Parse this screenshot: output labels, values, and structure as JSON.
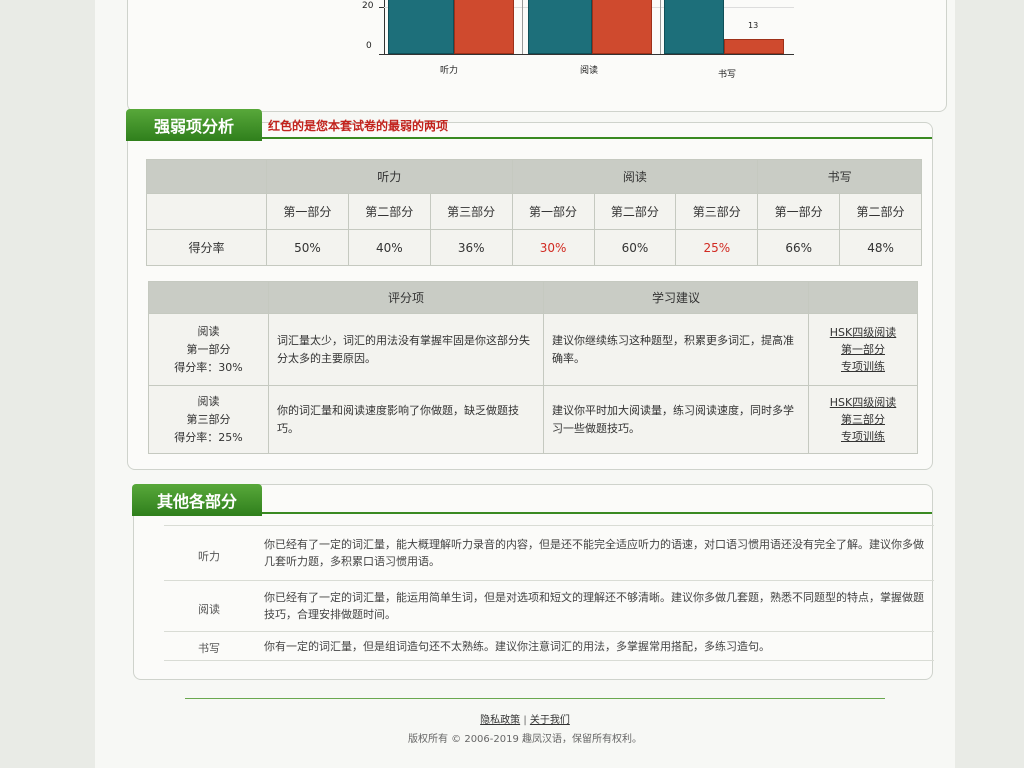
{
  "chart_data": {
    "type": "bar",
    "categories": [
      "听力",
      "阅读",
      "书写"
    ],
    "y_ticks_visible": [
      "20",
      "0"
    ],
    "series": [
      {
        "color": "#1d6f7a",
        "values": [
          null,
          null,
          null
        ]
      },
      {
        "color": "#cf4a2e",
        "values": [
          null,
          null,
          13
        ]
      }
    ],
    "data_labels": [
      "13"
    ]
  },
  "weak": {
    "title": "强弱项分析",
    "note": "红色的是您本套试卷的最弱的两项",
    "groups": [
      "听力",
      "阅读",
      "书写"
    ],
    "parts": [
      "第一部分",
      "第二部分",
      "第三部分",
      "第一部分",
      "第二部分",
      "第三部分",
      "第一部分",
      "第二部分"
    ],
    "row_label": "得分率",
    "rates": [
      "50%",
      "40%",
      "36%",
      "30%",
      "60%",
      "25%",
      "66%",
      "48%"
    ],
    "highlight_color": "#d12a22"
  },
  "advice": {
    "headers": [
      "评分项",
      "学习建议"
    ],
    "rows": [
      {
        "section": "阅读",
        "part": "第一部分",
        "rate": "得分率：30%",
        "eval": "词汇量太少，词汇的用法没有掌握牢固是你这部分失分太多的主要原因。",
        "suggest": "建议你继续练习这种题型，积累更多词汇，提高准确率。",
        "link1": "HSK四级阅读",
        "link2": "第一部分",
        "link3": "专项训练"
      },
      {
        "section": "阅读",
        "part": "第三部分",
        "rate": "得分率：25%",
        "eval": "你的词汇量和阅读速度影响了你做题，缺乏做题技巧。",
        "suggest": "建议你平时加大阅读量，练习阅读速度，同时多学习一些做题技巧。",
        "link1": "HSK四级阅读",
        "link2": "第三部分",
        "link3": "专项训练"
      }
    ]
  },
  "other": {
    "title": "其他各部分",
    "rows": [
      {
        "cat": "听力",
        "text": "你已经有了一定的词汇量，能大概理解听力录音的内容，但是还不能完全适应听力的语速，对口语习惯用语还没有完全了解。建议你多做几套听力题，多积累口语习惯用语。"
      },
      {
        "cat": "阅读",
        "text": "你已经有了一定的词汇量，能运用简单生词，但是对选项和短文的理解还不够清晰。建议你多做几套题，熟悉不同题型的特点，掌握做题技巧，合理安排做题时间。"
      },
      {
        "cat": "书写",
        "text": "你有一定的词汇量，但是组词造句还不太熟练。建议你注意词汇的用法，多掌握常用搭配，多练习造句。"
      }
    ]
  },
  "footer": {
    "link_privacy": "隐私政策",
    "separator": "|",
    "link_about": "关于我们",
    "copyright": "版权所有 © 2006-2019 趣凤汉语，保留所有权利。"
  }
}
